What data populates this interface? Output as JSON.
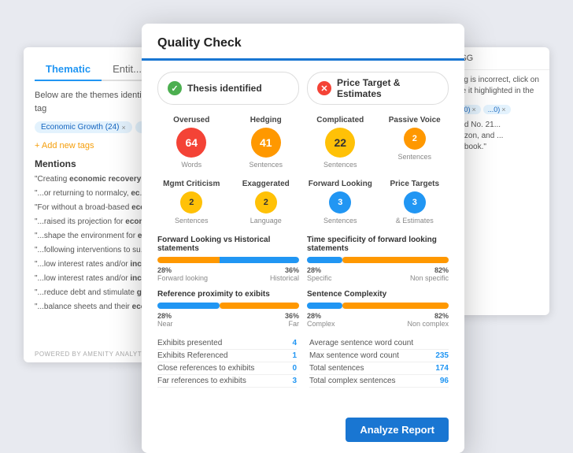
{
  "left_panel": {
    "tabs": [
      "Thematic",
      "Entit..."
    ],
    "active_tab": "Thematic",
    "body_text": "Below are the themes identified highlighted in the text. If the tag",
    "tags": [
      {
        "label": "Economic Growth (24)",
        "has_x": true
      },
      {
        "label": "Po...",
        "has_x": true
      }
    ],
    "add_tag_label": "+ Add new tags",
    "mentions_title": "Mentions",
    "mentions": [
      {
        "text": "\"Creating economic recovery...\""
      },
      {
        "text": "\"...or returning to normalcy, ec...\""
      },
      {
        "text": "\"For without a broad-based eco...\""
      },
      {
        "text": "\"...raised its projection for econ...\""
      },
      {
        "text": "\"...shape the environment for e... challenges...\""
      },
      {
        "text": "\"...following interventions to su...\""
      },
      {
        "text": "\"...low interest rates and/or inc...\""
      },
      {
        "text": "\"...low interest rates and/or inc...\""
      },
      {
        "text": "\"...reduce debt and stimulate g...\""
      },
      {
        "text": "\"...balance sheets and their eco...\""
      }
    ],
    "powered_by": "POWERED BY AMENITY ANALYTICS"
  },
  "right_panel": {
    "header": "ESG",
    "refresh_icon": "↻",
    "items": [
      "...nd No. 21...",
      "...azon, and ...",
      "...ebook.\""
    ],
    "tags": [
      {
        "label": "...0)",
        "has_x": true
      },
      {
        "label": "...0)",
        "has_x": true
      }
    ],
    "body_text": "ging is incorrect, click on see it highlighted in the"
  },
  "modal": {
    "title": "Quality Check",
    "thesis_pills": [
      {
        "label": "Thesis identified",
        "type": "success"
      },
      {
        "label": "Price Target & Estimates",
        "type": "error"
      }
    ],
    "metrics_row1": [
      {
        "label": "Overused",
        "value": "64",
        "sub": "Words",
        "color": "red"
      },
      {
        "label": "Hedging",
        "value": "41",
        "sub": "Sentences",
        "color": "orange"
      },
      {
        "label": "Complicated",
        "value": "22",
        "sub": "Sentences",
        "color": "yellow"
      },
      {
        "label": "Passive Voice",
        "value": "2",
        "sub": "Sentences",
        "color": "small-orange"
      }
    ],
    "metrics_row2": [
      {
        "label": "Mgmt Criticism",
        "value": "2",
        "sub": "Sentences",
        "color": "small-yellow"
      },
      {
        "label": "Exaggerated",
        "value": "2",
        "sub": "Language",
        "color": "small-yellow"
      },
      {
        "label": "Forward Looking",
        "value": "3",
        "sub": "Sentences",
        "color": "blue"
      },
      {
        "label": "Price Targets",
        "value": "3",
        "sub": "& Estimates",
        "color": "blue"
      }
    ],
    "bars": [
      {
        "title": "Forward Looking vs Historical statements",
        "left_pct": 28,
        "right_pct": 36,
        "left_label": "Forward looking",
        "right_label": "Historical",
        "left_color": "orange",
        "right_color": "blue"
      },
      {
        "title": "Time specificity of forward looking statements",
        "left_pct": 28,
        "right_pct": 82,
        "left_label": "Specific",
        "right_label": "Non specific",
        "left_color": "blue",
        "right_color": "orange"
      },
      {
        "title": "Reference proximity to exibits",
        "left_pct": 28,
        "right_pct": 36,
        "left_label": "Near",
        "right_label": "Far",
        "left_color": "blue",
        "right_color": "orange"
      },
      {
        "title": "Sentence Complexity",
        "left_pct": 28,
        "right_pct": 82,
        "left_label": "Complex",
        "right_label": "Non complex",
        "left_color": "blue",
        "right_color": "orange"
      }
    ],
    "stats_left": [
      {
        "label": "Exhibits presented",
        "value": "4"
      },
      {
        "label": "Exhibits Referenced",
        "value": "1"
      },
      {
        "label": "Close references to exhibits",
        "value": "0"
      },
      {
        "label": "Far references to exhibits",
        "value": "3"
      }
    ],
    "stats_right": [
      {
        "label": "Average sentence word count",
        "value": ""
      },
      {
        "label": "Max sentence word count",
        "value": "235"
      },
      {
        "label": "Total sentences",
        "value": "174"
      },
      {
        "label": "Total complex sentences",
        "value": "96"
      }
    ],
    "analyze_button": "Analyze Report"
  }
}
